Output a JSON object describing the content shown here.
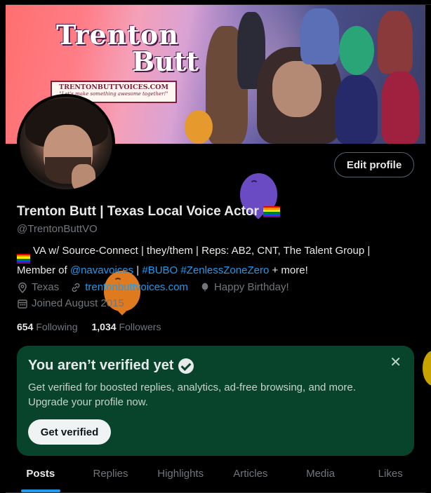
{
  "banner": {
    "title_line1": "Trenton",
    "title_line2": "Butt",
    "url": "TRENTONBUTTVOICES.COM",
    "tagline": "\"Let's make something awesome together!\""
  },
  "profile": {
    "edit_button": "Edit profile",
    "display_name": "Trenton Butt | Texas Local Voice Actor",
    "handle": "@TrentonButtVO",
    "bio": {
      "line1": "VA w/ Source-Connect | they/them | Reps: AB2, CNT, The Talent Group |",
      "line2_prefix": "Member of ",
      "mention": "@navavoices",
      "hashtag1": "#BUBO",
      "hashtag2": "#ZenlessZoneZero",
      "suffix": " + more!"
    },
    "location": "Texas",
    "website": "trentonbuttvoices.com",
    "birthday": "Happy Birthday!",
    "joined": "Joined August 2015",
    "following_count": "654",
    "following_label": "Following",
    "followers_count": "1,034",
    "followers_label": "Followers"
  },
  "verify_card": {
    "title": "You aren’t verified yet",
    "text": "Get verified for boosted replies, analytics, ad-free browsing, and more. Upgrade your profile now.",
    "button": "Get verified",
    "close_icon": "x-icon"
  },
  "tabs": [
    {
      "label": "Posts",
      "active": true
    },
    {
      "label": "Replies",
      "active": false
    },
    {
      "label": "Highlights",
      "active": false
    },
    {
      "label": "Articles",
      "active": false
    },
    {
      "label": "Media",
      "active": false
    },
    {
      "label": "Likes",
      "active": false
    }
  ],
  "colors": {
    "background": "#000000",
    "accent": "#1d9bf0",
    "secondary_text": "#71767b",
    "verify_card_bg": "#07442b",
    "balloon_purple": "#6a4bc4",
    "balloon_orange": "#e07a1f"
  },
  "pride_flag_colors": [
    "#e40303",
    "#ff8c00",
    "#ffed00",
    "#008026",
    "#004dff",
    "#750787"
  ]
}
